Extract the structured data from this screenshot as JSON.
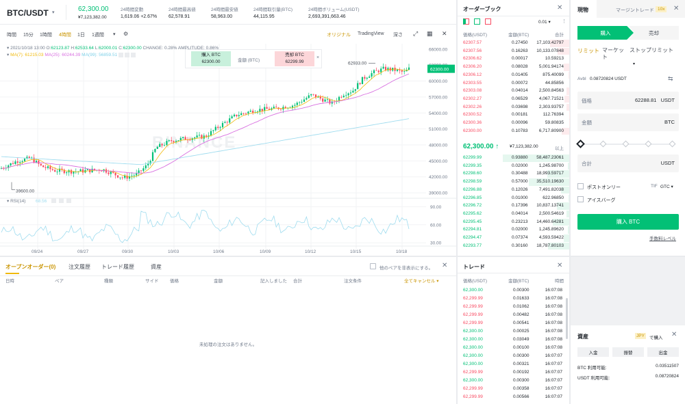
{
  "header": {
    "pair": "BTC/USDT",
    "price": "62,300.00",
    "price_jpy": "¥7,123,382.00",
    "stats": [
      {
        "label": "24時間変動",
        "value": "1,619.06 +2.67%",
        "color": "green"
      },
      {
        "label": "24時間最高値",
        "value": "62,578.91"
      },
      {
        "label": "24時間最安値",
        "value": "58,963.00"
      },
      {
        "label": "24時間取引量(BTC)",
        "value": "44,115.95"
      },
      {
        "label": "24時間ボリューム(USDT)",
        "value": "2,693,391,663.46"
      }
    ]
  },
  "chart_toolbar": {
    "intervals": [
      "時間",
      "15分",
      "1時間",
      "4時間",
      "1日",
      "1週間"
    ],
    "active": "4時間",
    "views": [
      "オリジナル",
      "TradingView",
      "深さ"
    ]
  },
  "chart_info": {
    "date": "2021/10/18 13:00",
    "open_label": "O:",
    "open": "62123.87",
    "high_label": "H:",
    "high": "62533.64",
    "low_label": "L:",
    "low": "62000.01",
    "close_label": "C:",
    "close": "62300.00",
    "change": "CHANGE: 0.28%",
    "amplitude": "AMPLITUDE: 0.86%",
    "ma7": "MA(7): 61215.03",
    "ma25": "MA(25): 60244.39",
    "ma99": "MA(99): 56859.51"
  },
  "chart_overlay": {
    "buy_label": "購入 BTC",
    "buy_price": "62300.00",
    "amount_label": "金額 (BTC)",
    "sell_label": "売却 BTC",
    "sell_price": "62299.99",
    "close": "×"
  },
  "watermark": "BINANCE",
  "chart_data": {
    "type": "candlestick",
    "x_ticks": [
      "09/24",
      "09/27",
      "09/30",
      "10/03",
      "10/06",
      "10/09",
      "10/12",
      "10/15",
      "10/18"
    ],
    "y_ticks": [
      60000,
      57000,
      54000,
      51000,
      48000,
      45000,
      42000,
      39000
    ],
    "top_tick": "66000.00",
    "price_axis": [
      "66000.00",
      "63000.00",
      "60000.00",
      "57000.00",
      "54000.00",
      "51000.00",
      "48000.00",
      "45000.00",
      "42000.00",
      "39000.00"
    ],
    "high_annotation": "62933.00",
    "low_annotation": "39600.00",
    "last_price": "62300.00",
    "rsi_label": "RSI(14)",
    "rsi_value": "68.56",
    "rsi_ticks": [
      "90.00",
      "60.00",
      "30.00"
    ],
    "ylim": [
      38500,
      67000
    ]
  },
  "orders_panel": {
    "tabs": [
      "オープンオーダー(0)",
      "注文履歴",
      "トレード履歴",
      "資産"
    ],
    "hide_pairs": "他のペアを非表示にする。",
    "columns": [
      "日時",
      "ペア",
      "種類",
      "サイド",
      "価格",
      "金額",
      "記入しました",
      "合計",
      "注文条件"
    ],
    "cancel_all": "全てキャンセル",
    "empty": "未処理の注文はありません。"
  },
  "orderbook": {
    "title": "オーダーブック",
    "precision": "0.01",
    "col_price": "価格(USDT)",
    "col_amount": "金額(BTC)",
    "col_total": "合計",
    "asks": [
      [
        "62307.57",
        "0.27450",
        "17,103.42797"
      ],
      [
        "62307.56",
        "0.16263",
        "10,133.07848"
      ],
      [
        "62306.62",
        "0.00017",
        "10.59213"
      ],
      [
        "62306.20",
        "0.08028",
        "5,001.94174"
      ],
      [
        "62306.12",
        "0.01405",
        "875.40099"
      ],
      [
        "62303.55",
        "0.00072",
        "44.85856"
      ],
      [
        "62303.08",
        "0.04014",
        "2,500.84563"
      ],
      [
        "62302.27",
        "0.06529",
        "4,067.71521"
      ],
      [
        "62302.26",
        "0.03698",
        "2,303.93757"
      ],
      [
        "62300.52",
        "0.00181",
        "112.76394"
      ],
      [
        "62300.36",
        "0.00096",
        "59.80835"
      ],
      [
        "62300.00",
        "0.10783",
        "6,717.80900"
      ]
    ],
    "mid_price": "62,300.00",
    "mid_jpy": "¥7,123,382.00",
    "more": "以上",
    "bids": [
      [
        "62299.99",
        "0.93880",
        "58,487.23061"
      ],
      [
        "62299.35",
        "0.02000",
        "1,245.98700"
      ],
      [
        "62298.60",
        "0.30488",
        "18,993.59717"
      ],
      [
        "62298.59",
        "0.57000",
        "35,510.19630"
      ],
      [
        "62296.88",
        "0.12026",
        "7,491.82038"
      ],
      [
        "62296.85",
        "0.01000",
        "622.96850"
      ],
      [
        "62296.72",
        "0.17396",
        "10,837.13741"
      ],
      [
        "62295.62",
        "0.04014",
        "2,500.54619"
      ],
      [
        "62295.45",
        "0.23213",
        "14,460.64281"
      ],
      [
        "62294.81",
        "0.02000",
        "1,245.89620"
      ],
      [
        "62294.47",
        "0.07374",
        "4,593.59422"
      ],
      [
        "62293.77",
        "0.30160",
        "18,787.80103"
      ]
    ]
  },
  "trades": {
    "title": "トレード",
    "col_price": "価格(USDT)",
    "col_amount": "金額(BTC)",
    "col_time": "時間",
    "rows": [
      [
        "62,300.00",
        "0.00300",
        "16:07:08",
        "g"
      ],
      [
        "62,299.99",
        "0.01633",
        "16:07:08",
        "r"
      ],
      [
        "62,299.99",
        "0.01062",
        "16:07:08",
        "r"
      ],
      [
        "62,299.99",
        "0.00482",
        "16:07:08",
        "r"
      ],
      [
        "62,299.99",
        "0.00541",
        "16:07:08",
        "r"
      ],
      [
        "62,300.00",
        "0.00025",
        "16:07:08",
        "g"
      ],
      [
        "62,300.00",
        "0.03049",
        "16:07:08",
        "g"
      ],
      [
        "62,300.00",
        "0.00100",
        "16:07:08",
        "g"
      ],
      [
        "62,300.00",
        "0.00300",
        "16:07:07",
        "g"
      ],
      [
        "62,300.00",
        "0.00321",
        "16:07:07",
        "g"
      ],
      [
        "62,299.99",
        "0.00192",
        "16:07:07",
        "r"
      ],
      [
        "62,300.00",
        "0.00300",
        "16:07:07",
        "g"
      ],
      [
        "62,299.99",
        "0.00358",
        "16:07:07",
        "r"
      ],
      [
        "62,299.99",
        "0.00566",
        "16:07:07",
        "r"
      ]
    ]
  },
  "order_form": {
    "tab_spot": "現物",
    "tab_margin": "マージントレード",
    "leverage": "10x",
    "buy_tab": "購入",
    "sell_tab": "売却",
    "types": [
      "リミット",
      "マーケット",
      "ストップリミット"
    ],
    "avbl_label": "Avbl",
    "avbl_value": "0.08720824 USDT",
    "price_label": "価格",
    "price_value": "62288.81",
    "price_unit": "USDT",
    "amount_label": "金額",
    "amount_unit": "BTC",
    "total_label": "合計",
    "total_unit": "USDT",
    "post_only": "ポストオンリー",
    "tif_label": "TIF",
    "tif_value": "GTC",
    "iceberg": "アイスバーグ",
    "submit": "購入 BTC",
    "fee": "手数料レベル"
  },
  "assets": {
    "title": "資産",
    "jpy": "JPY",
    "buy_with": "で購入",
    "deposit": "入金",
    "transfer": "振替",
    "withdraw": "出金",
    "btc_label": "BTC 利用可能:",
    "btc_value": "0.03511507",
    "usdt_label": "USDT 利用可能:",
    "usdt_value": "0.08720824"
  },
  "colors": {
    "green": "#02c076",
    "red": "#f84960",
    "gold": "#f0b90b",
    "ma7": "#f0b90b",
    "ma25": "#d86fe0",
    "ma99": "#7fd0e8"
  }
}
